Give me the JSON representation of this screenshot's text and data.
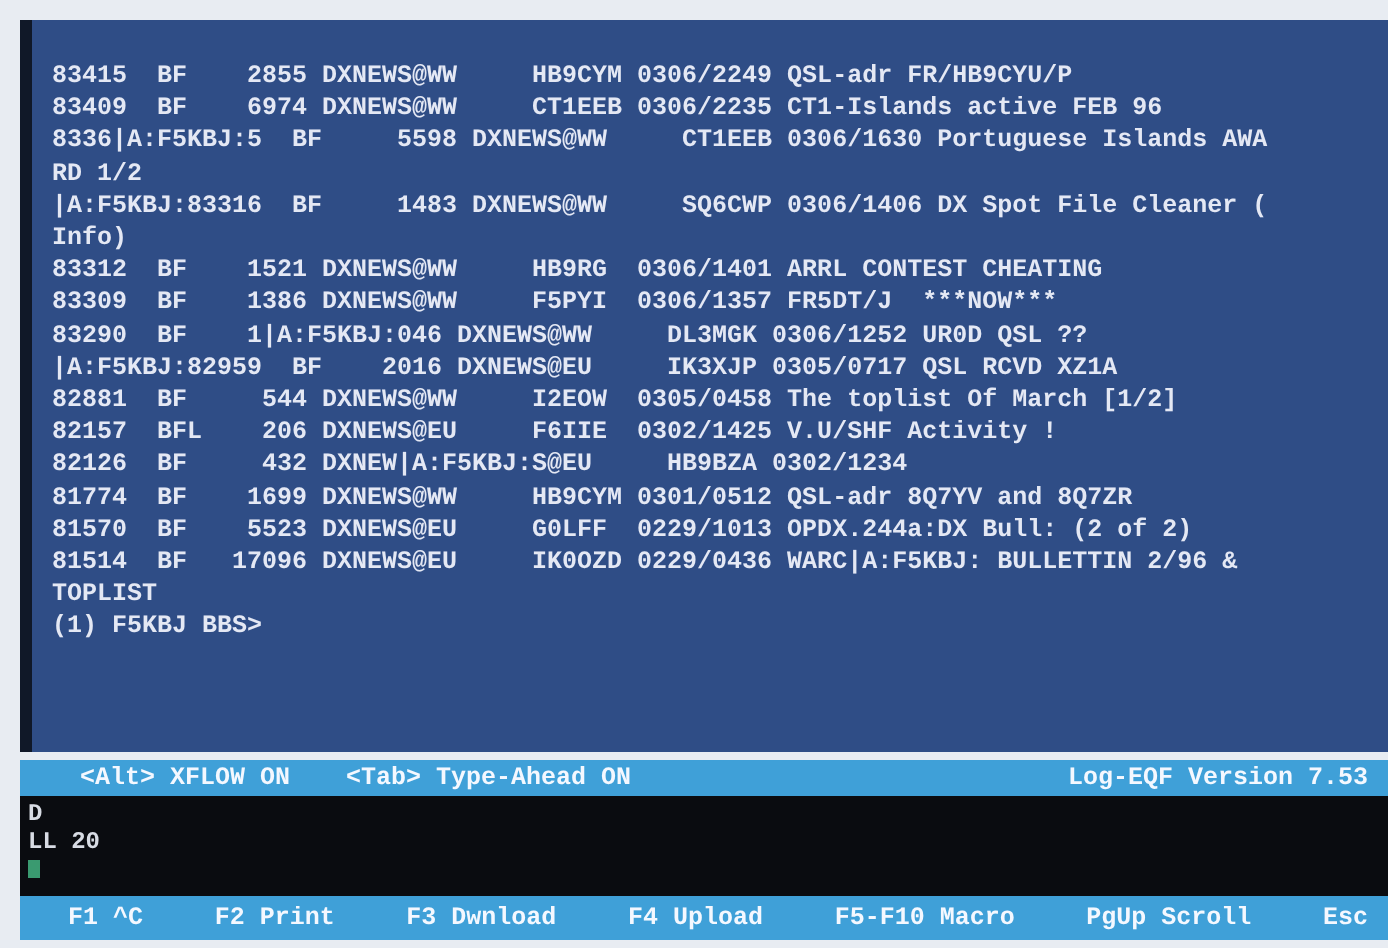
{
  "message_list": [
    "83415  BF    2855 DXNEWS@WW     HB9CYM 0306/2249 QSL-adr FR/HB9CYU/P",
    "83409  BF    6974 DXNEWS@WW     CT1EEB 0306/2235 CT1-Islands active FEB 96",
    "8336|A:F5KBJ:5  BF     5598 DXNEWS@WW     CT1EEB 0306/1630 Portuguese Islands AWA",
    "RD 1/2",
    "|A:F5KBJ:83316  BF     1483 DXNEWS@WW     SQ6CWP 0306/1406 DX Spot File Cleaner (",
    "Info)",
    "83312  BF    1521 DXNEWS@WW     HB9RG  0306/1401 ARRL CONTEST CHEATING",
    "83309  BF    1386 DXNEWS@WW     F5PYI  0306/1357 FR5DT/J  ***NOW***",
    "83290  BF    1|A:F5KBJ:046 DXNEWS@WW     DL3MGK 0306/1252 UR0D QSL ??",
    "|A:F5KBJ:82959  BF    2016 DXNEWS@EU     IK3XJP 0305/0717 QSL RCVD XZ1A",
    "82881  BF     544 DXNEWS@WW     I2EOW  0305/0458 The toplist Of March [1/2]",
    "82157  BFL    206 DXNEWS@EU     F6IIE  0302/1425 V.U/SHF Activity !",
    "82126  BF     432 DXNEW|A:F5KBJ:S@EU     HB9BZA 0302/1234",
    "81774  BF    1699 DXNEWS@WW     HB9CYM 0301/0512 QSL-adr 8Q7YV and 8Q7ZR",
    "81570  BF    5523 DXNEWS@EU     G0LFF  0229/1013 OPDX.244a:DX Bull: (2 of 2)",
    "81514  BF   17096 DXNEWS@EU     IK0OZD 0229/0436 WARC|A:F5KBJ: BULLETTIN 2/96 &",
    "TOPLIST",
    "(1) F5KBJ BBS>"
  ],
  "status_bar": [
    "<Alt> XFLOW ON",
    "<Tab> Type-Ahead ON",
    "Log-EQF Version 7.53"
  ],
  "input_lines": [
    "D",
    "LL 20"
  ],
  "function_keys": [
    "F1 ^C",
    "F2 Print",
    "F3 Dwnload",
    "F4 Upload",
    "F5-F10 Macro",
    "PgUp Scroll",
    "Esc"
  ]
}
